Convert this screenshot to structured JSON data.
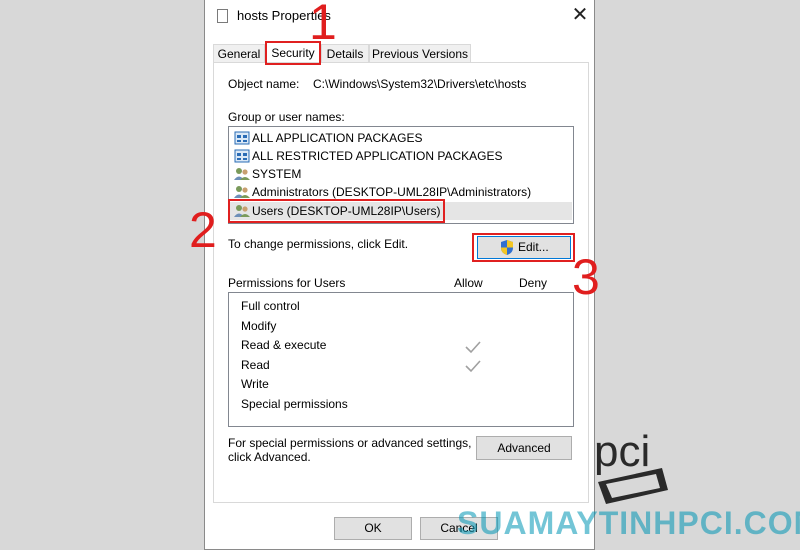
{
  "window": {
    "title": "hosts Properties",
    "close_glyph": "✕"
  },
  "tabs": [
    {
      "label": "General"
    },
    {
      "label": "Security"
    },
    {
      "label": "Details"
    },
    {
      "label": "Previous Versions"
    }
  ],
  "object_name": {
    "label": "Object name:",
    "value": "C:\\Windows\\System32\\Drivers\\etc\\hosts"
  },
  "groups": {
    "label": "Group or user names:",
    "items": [
      {
        "label": "ALL APPLICATION PACKAGES",
        "icon": "app-packages-icon"
      },
      {
        "label": "ALL RESTRICTED APPLICATION PACKAGES",
        "icon": "app-packages-icon"
      },
      {
        "label": "SYSTEM",
        "icon": "users-icon"
      },
      {
        "label": "Administrators (DESKTOP-UML28IP\\Administrators)",
        "icon": "users-icon"
      },
      {
        "label": "Users (DESKTOP-UML28IP\\Users)",
        "icon": "users-icon",
        "selected": true
      }
    ]
  },
  "change_hint": "To change permissions, click Edit.",
  "edit_button": "Edit...",
  "permissions": {
    "label": "Permissions for Users",
    "allow_header": "Allow",
    "deny_header": "Deny",
    "items": [
      {
        "name": "Full control",
        "allow": false,
        "deny": false
      },
      {
        "name": "Modify",
        "allow": false,
        "deny": false
      },
      {
        "name": "Read & execute",
        "allow": true,
        "deny": false
      },
      {
        "name": "Read",
        "allow": true,
        "deny": false
      },
      {
        "name": "Write",
        "allow": false,
        "deny": false
      },
      {
        "name": "Special permissions",
        "allow": false,
        "deny": false
      }
    ]
  },
  "advanced": {
    "hint_line1": "For special permissions or advanced settings,",
    "hint_line2": "click Advanced.",
    "button": "Advanced"
  },
  "footer": {
    "ok": "OK",
    "cancel": "Cancel"
  },
  "annotations": {
    "n1": "1",
    "n2": "2",
    "n3": "3",
    "color": "#e01e1e"
  },
  "watermark": {
    "logo": "pci",
    "text": "SUAMAYTINHPCI.COM"
  }
}
